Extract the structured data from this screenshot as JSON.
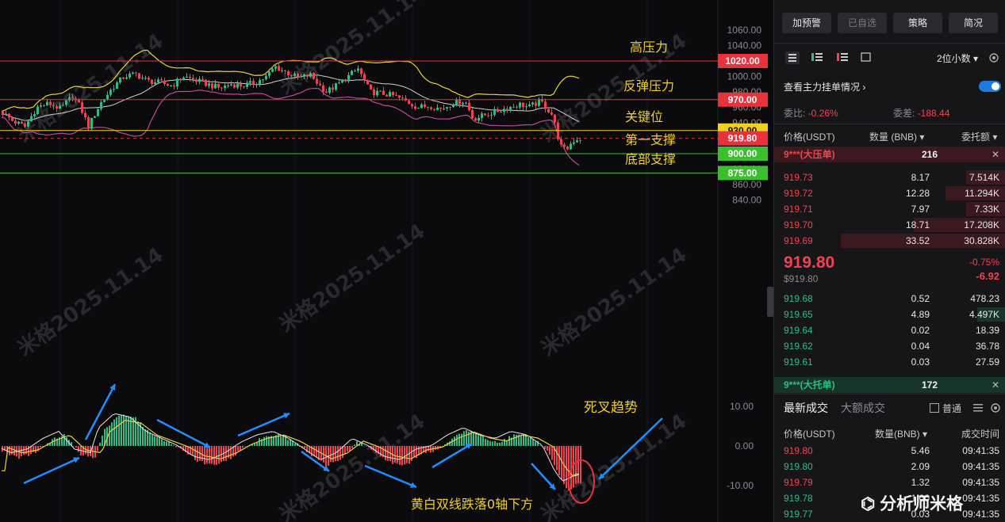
{
  "chart_data": {
    "type": "candlestick",
    "y_axis_ticks": [
      "1060.00",
      "1040.00",
      "1020.00",
      "1000.00",
      "980.00",
      "960.00",
      "940.00",
      "920.00",
      "900.00",
      "880.00",
      "860.00",
      "840.00"
    ],
    "ylim": [
      836,
      1068
    ],
    "levels": [
      {
        "label": "高压力",
        "value": 1020.0,
        "tag": "1020.00",
        "color": "#e8323c"
      },
      {
        "label": "反弹压力",
        "value": 970.0,
        "tag": "970.00",
        "color": "#e8323c"
      },
      {
        "label": "关键位",
        "value": 930.0,
        "tag": "930.00",
        "color": "#f0d020"
      },
      {
        "label": "",
        "value": 919.8,
        "tag": "919.80",
        "color": "#e8323c"
      },
      {
        "label": "第一支撑",
        "value": 900.0,
        "tag": "900.00",
        "color": "#3cbf2e"
      },
      {
        "label": "底部支撑",
        "value": 875.0,
        "tag": "875.00",
        "color": "#3cbf2e"
      }
    ],
    "macd_ticks": [
      "10.00",
      "0.00",
      "-10.00"
    ],
    "macd_ylim": [
      -13,
      15
    ],
    "annotations": [
      "死叉趋势",
      "黄白双线跌落0轴下方"
    ],
    "watermark": "米格2025.11.14",
    "brand": "分析师米格"
  },
  "panel": {
    "buttons": [
      "加预警",
      "已自选",
      "策略",
      "简况"
    ],
    "decimals": "2位小数",
    "depth_link": "查看主力挂单情况",
    "ratio_label": "委比:",
    "ratio_value": "-0.26%",
    "diff_label": "委差:",
    "diff_value": "-188.44",
    "col_price": "价格(USDT)",
    "col_qty": "数量 (BNB)",
    "col_total": "委托额",
    "big_ask_label": "9***(大压单)",
    "big_ask_qty": "216",
    "asks": [
      {
        "p": "919.73",
        "q": "8.17",
        "t": "7.514K",
        "w": 0.24
      },
      {
        "p": "919.72",
        "q": "12.28",
        "t": "11.294K",
        "w": 0.36
      },
      {
        "p": "919.71",
        "q": "7.97",
        "t": "7.33K",
        "w": 0.24
      },
      {
        "p": "919.70",
        "q": "18.71",
        "t": "17.208K",
        "w": 0.55
      },
      {
        "p": "919.69",
        "q": "33.52",
        "t": "30.828K",
        "w": 0.99
      }
    ],
    "last_price": "919.80",
    "last_usd": "$919.80",
    "change_pct": "-0.75%",
    "change_abs": "-6.92",
    "bids": [
      {
        "p": "919.68",
        "q": "0.52",
        "t": "478.23",
        "w": 0.0
      },
      {
        "p": "919.65",
        "q": "4.89",
        "t": "4.497K",
        "w": 0.17
      },
      {
        "p": "919.64",
        "q": "0.02",
        "t": "18.39",
        "w": 0.0
      },
      {
        "p": "919.62",
        "q": "0.04",
        "t": "36.78",
        "w": 0.0
      },
      {
        "p": "919.61",
        "q": "0.03",
        "t": "27.59",
        "w": 0.0
      }
    ],
    "big_bid_label": "9***(大托单)",
    "big_bid_qty": "172",
    "trades_tab": "最新成交",
    "big_trades_tab": "大额成交",
    "normal_label": "普通",
    "tr_price": "价格(USDT)",
    "tr_qty": "数量(BNB)",
    "tr_time": "成交时间",
    "trades": [
      {
        "p": "919.80",
        "q": "5.46",
        "t": "09:41:35",
        "c": "red"
      },
      {
        "p": "919.80",
        "q": "2.09",
        "t": "09:41:35",
        "c": "green"
      },
      {
        "p": "919.79",
        "q": "1.32",
        "t": "09:41:35",
        "c": "red"
      },
      {
        "p": "919.78",
        "q": "1.00",
        "t": "09:41:35",
        "c": "green"
      },
      {
        "p": "919.77",
        "q": "0.03",
        "t": "09:41:35",
        "c": "green"
      }
    ]
  }
}
